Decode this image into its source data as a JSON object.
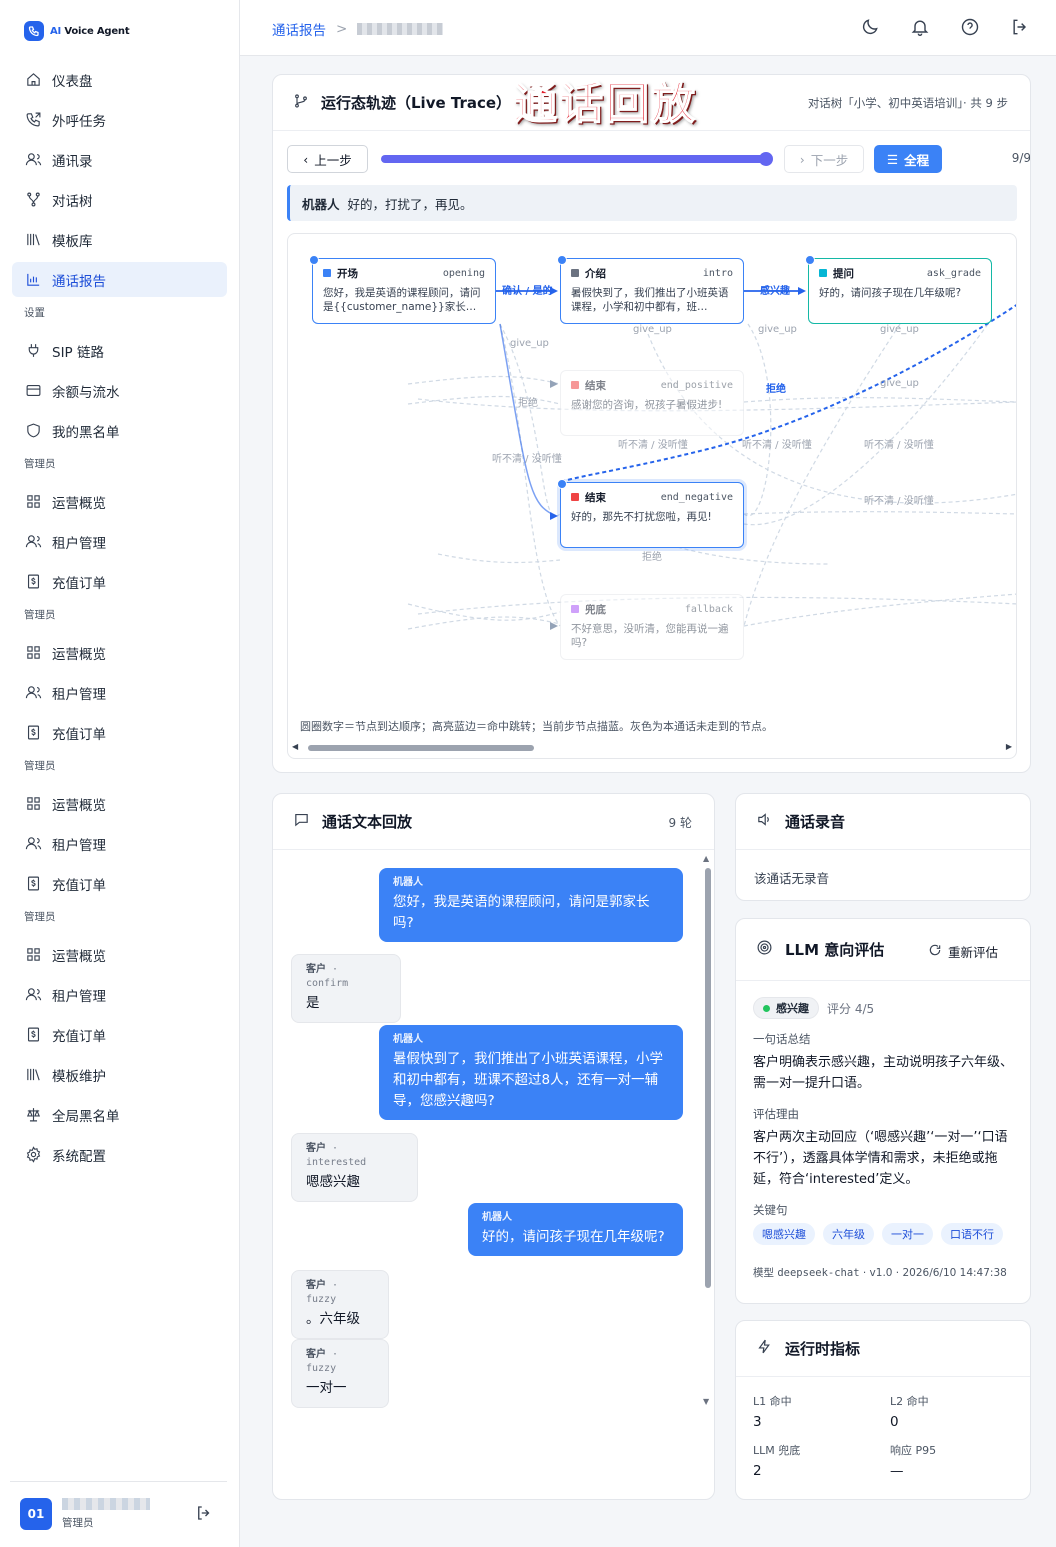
{
  "brand": {
    "name_prefix": "AI",
    "name": " Voice Agent"
  },
  "sidebar": {
    "main_items": [
      {
        "label": "仪表盘",
        "icon": "home-icon"
      },
      {
        "label": "外呼任务",
        "icon": "phone-out-icon"
      },
      {
        "label": "通讯录",
        "icon": "contacts-icon"
      },
      {
        "label": "对话树",
        "icon": "tree-icon"
      },
      {
        "label": "模板库",
        "icon": "library-icon"
      },
      {
        "label": "通话报告",
        "icon": "bar-chart-icon",
        "active": true
      }
    ],
    "settings_title": "设置",
    "settings_items": [
      {
        "label": "SIP 链路",
        "icon": "plug-icon"
      },
      {
        "label": "余额与流水",
        "icon": "card-icon"
      },
      {
        "label": "我的黑名单",
        "icon": "shield-icon"
      }
    ],
    "admin_groups": [
      {
        "title": "管理员",
        "items": [
          "运营概览",
          "租户管理",
          "充值订单"
        ]
      },
      {
        "title": "管理员",
        "items": [
          "运营概览",
          "租户管理",
          "充值订单"
        ]
      },
      {
        "title": "管理员",
        "items": [
          "运营概览",
          "租户管理",
          "充值订单"
        ]
      },
      {
        "title": "管理员",
        "items": [
          "运营概览",
          "租户管理",
          "充值订单",
          "模板维护",
          "全局黑名单",
          "系统配置"
        ]
      }
    ],
    "user": {
      "avatar_text": "01",
      "role": "管理员"
    }
  },
  "header": {
    "breadcrumb_root": "通话报告",
    "breadcrumb_sep": ">"
  },
  "trace": {
    "title": "运行态轨迹（Live Trace）",
    "stamp": "通话回放",
    "meta": "对话树「小学、初中英语培训」· 共 9 步",
    "prev_label": "上一步",
    "next_label": "下一步",
    "full_label": "全程",
    "progress": 1.0,
    "step_count": "9/9",
    "current_say": {
      "speaker": "机器人",
      "text": "好的，打扰了，再见。"
    },
    "nodes": [
      {
        "name": "开场",
        "key": "opening",
        "text": "您好，我是英语的课程顾问，请问是{{customer_name}}家长…",
        "color": "#3b82f6",
        "state": "hit",
        "badge": true
      },
      {
        "name": "介绍",
        "key": "intro",
        "text": "暑假快到了，我们推出了小班英语课程，小学和初中都有，班…",
        "color": "#6b7280",
        "state": "hit",
        "badge": true
      },
      {
        "name": "提问",
        "key": "ask_grade",
        "text": "好的，请问孩子现在几年级呢?",
        "color": "#06b6d4",
        "state": "hit-cyan",
        "badge": true
      },
      {
        "name": "结束",
        "key": "end_positive",
        "text": "感谢您的咨询，祝孩子暑假进步!",
        "color": "#ef4444",
        "state": "dim"
      },
      {
        "name": "结束",
        "key": "end_negative",
        "text": "好的，那先不打扰您啦，再见!",
        "color": "#ef4444",
        "state": "current",
        "badge": true
      },
      {
        "name": "兜底",
        "key": "fallback",
        "text": "不好意思，没听清，您能再说一遍吗?",
        "color": "#a855f7",
        "state": "dim"
      }
    ],
    "edge_labels": [
      {
        "text": "确认 / 是的",
        "hot": true
      },
      {
        "text": "感兴趣",
        "hot": true
      },
      {
        "text": "拒绝",
        "hot": true
      },
      {
        "text": "give_up"
      },
      {
        "text": "give_up"
      },
      {
        "text": "give_up"
      },
      {
        "text": "give_up"
      },
      {
        "text": "give_up"
      },
      {
        "text": "听不清 / 没听懂"
      },
      {
        "text": "听不清 / 没听懂"
      },
      {
        "text": "听不清 / 没听懂"
      },
      {
        "text": "听不清 / 没听懂"
      },
      {
        "text": "听不清 / 没听懂"
      },
      {
        "text": "拒绝"
      },
      {
        "text": "拒绝"
      }
    ],
    "legend": "圆圈数字＝节点到达顺序；高亮蓝边＝命中跳转；当前步节点描蓝。灰色为本通话未走到的节点。"
  },
  "transcript": {
    "title": "通话文本回放",
    "count": "9 轮",
    "messages": [
      {
        "role": "bot",
        "speaker": "机器人",
        "text": "您好，我是英语的课程顾问，请问是郭家长吗?"
      },
      {
        "role": "cust",
        "speaker": "客户",
        "tag": "· confirm",
        "text": "是"
      },
      {
        "role": "bot",
        "speaker": "机器人",
        "text": "暑假快到了，我们推出了小班英语课程，小学和初中都有，班课不超过8人，还有一对一辅导，您感兴趣吗?"
      },
      {
        "role": "cust",
        "speaker": "客户",
        "tag": "· interested",
        "text": "嗯感兴趣"
      },
      {
        "role": "bot",
        "speaker": "机器人",
        "text": "好的，请问孩子现在几年级呢?"
      },
      {
        "role": "cust",
        "speaker": "客户",
        "tag": "· fuzzy",
        "text": "。六年级"
      },
      {
        "role": "cust",
        "speaker": "客户",
        "tag": "· fuzzy",
        "text": "一对一"
      }
    ]
  },
  "recording": {
    "title": "通话录音",
    "empty": "该通话无录音"
  },
  "llm": {
    "title": "LLM 意向评估",
    "reeval_label": "重新评估",
    "intent": "感兴趣",
    "score": "评分 4/5",
    "summary_label": "一句话总结",
    "summary": "客户明确表示感兴趣，主动说明孩子六年级、需一对一提升口语。",
    "reason_label": "评估理由",
    "reason": "客户两次主动回应（‘嗯感兴趣’‘一对一’‘口语不行’），透露具体学情和需求，未拒绝或拖延，符合‘interested’定义。",
    "keywords_label": "关键句",
    "keywords": [
      "嗯感兴趣",
      "六年级",
      "一对一",
      "口语不行"
    ],
    "model_prefix": "模型",
    "model_name": "deepseek-chat",
    "model_suffix": " · v1.0 · 2026/6/10 14:47:38",
    "intent_color": "#22c55e"
  },
  "metrics": {
    "title": "运行时指标",
    "items": [
      {
        "label": "L1 命中",
        "value": "3"
      },
      {
        "label": "L2 命中",
        "value": "0"
      },
      {
        "label": "LLM 兜底",
        "value": "2"
      },
      {
        "label": "响应 P95",
        "value": "—"
      }
    ]
  }
}
